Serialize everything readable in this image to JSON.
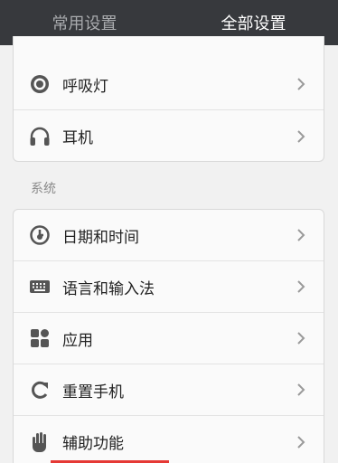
{
  "tabs": [
    {
      "label": "常用设置",
      "active": false
    },
    {
      "label": "全部设置",
      "active": true
    }
  ],
  "group1": {
    "items": [
      {
        "label": "呼吸灯",
        "icon": "breathing-light-icon"
      },
      {
        "label": "耳机",
        "icon": "headphones-icon"
      }
    ]
  },
  "system": {
    "section_label": "系统",
    "items": [
      {
        "label": "日期和时间",
        "icon": "clock-icon"
      },
      {
        "label": "语言和输入法",
        "icon": "keyboard-icon"
      },
      {
        "label": "应用",
        "icon": "apps-icon"
      },
      {
        "label": "重置手机",
        "icon": "reset-icon"
      },
      {
        "label": "辅助功能",
        "icon": "hand-icon"
      }
    ]
  },
  "colors": {
    "topbar": "#37393d",
    "background": "#f1f1f1",
    "accent": "#e53935"
  }
}
